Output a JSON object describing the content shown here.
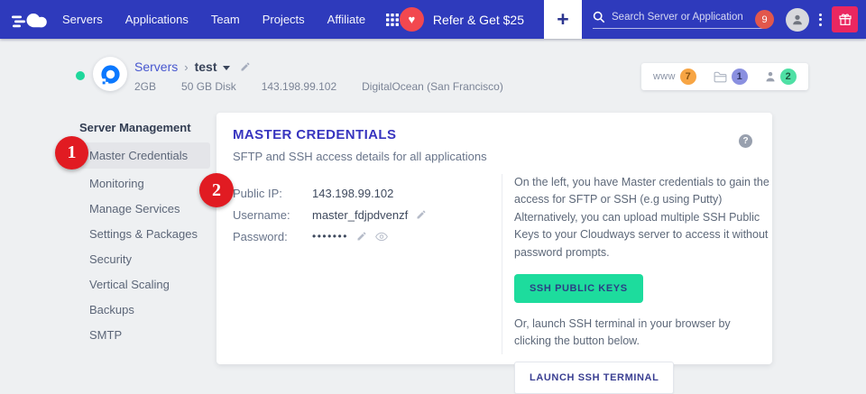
{
  "nav": {
    "menu": [
      "Servers",
      "Applications",
      "Team",
      "Projects",
      "Affiliate"
    ],
    "refer_label": "Refer & Get $25",
    "add_label": "+",
    "search_placeholder": "Search Server or Application",
    "notification_count": "9"
  },
  "header": {
    "breadcrumb_root": "Servers",
    "breadcrumb_separator": "›",
    "server_name": "test",
    "specs": [
      "2GB",
      "50 GB Disk",
      "143.198.99.102",
      "DigitalOcean (San Francisco)"
    ],
    "badges": [
      {
        "label": "www",
        "count": "7"
      },
      {
        "icon": "folder-icon",
        "count": "1"
      },
      {
        "icon": "person-icon",
        "count": "2"
      }
    ]
  },
  "sidebar": {
    "heading": "Server Management",
    "items": [
      {
        "label": "Master Credentials",
        "active": true
      },
      {
        "label": "Monitoring",
        "active": false
      },
      {
        "label": "Manage Services",
        "active": false
      },
      {
        "label": "Settings & Packages",
        "active": false
      },
      {
        "label": "Security",
        "active": false
      },
      {
        "label": "Vertical Scaling",
        "active": false
      },
      {
        "label": "Backups",
        "active": false
      },
      {
        "label": "SMTP",
        "active": false
      }
    ]
  },
  "main": {
    "title": "MASTER CREDENTIALS",
    "subtitle": "SFTP and SSH access details for all applications",
    "help_label": "?",
    "fields": [
      {
        "label": "Public IP:",
        "value": "143.198.99.102"
      },
      {
        "label": "Username:",
        "value": "master_fdjpdvenzf"
      },
      {
        "label": "Password:",
        "value": "•••••••"
      }
    ],
    "info_text": "On the left, you have Master credentials to gain the access for SFTP or SSH (e.g using Putty) Alternatively, you can upload multiple SSH Public Keys to your Cloudways server to access it without password prompts.",
    "ssh_keys_button": "SSH PUBLIC KEYS",
    "terminal_text": "Or, launch SSH terminal in your browser by clicking the button below.",
    "terminal_button": "LAUNCH SSH TERMINAL"
  },
  "annotations": {
    "step1": "1",
    "step2": "2"
  },
  "colors": {
    "nav_blue": "#2e3abc",
    "accent_indigo": "#3734bf",
    "success_green": "#1ddc9d",
    "annotation_red": "#e11b22",
    "refer_red": "#f2484f",
    "gift_pink": "#ea2760",
    "badge_orange": "#f7a544",
    "badge_purple": "#8a90e0",
    "badge_green": "#4fe0a5",
    "digitalocean_blue": "#0a78ff"
  }
}
